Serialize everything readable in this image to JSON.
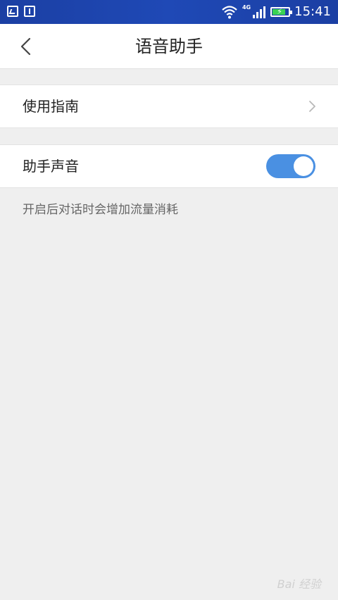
{
  "status_bar": {
    "time": "15:41",
    "network": "4G",
    "icons": [
      "image-notification-icon",
      "sim-card-icon",
      "wifi-icon",
      "cellular-signal-icon",
      "battery-charging-icon"
    ]
  },
  "header": {
    "title": "语音助手",
    "back_icon": "chevron-left-icon"
  },
  "settings": {
    "guide": {
      "label": "使用指南",
      "icon": "chevron-right-icon"
    },
    "assistant_voice": {
      "label": "助手声音",
      "enabled": true,
      "toggle_color": "#4a90e2"
    },
    "hint": "开启后对话时会增加流量消耗"
  },
  "watermark": "Bai 经验"
}
